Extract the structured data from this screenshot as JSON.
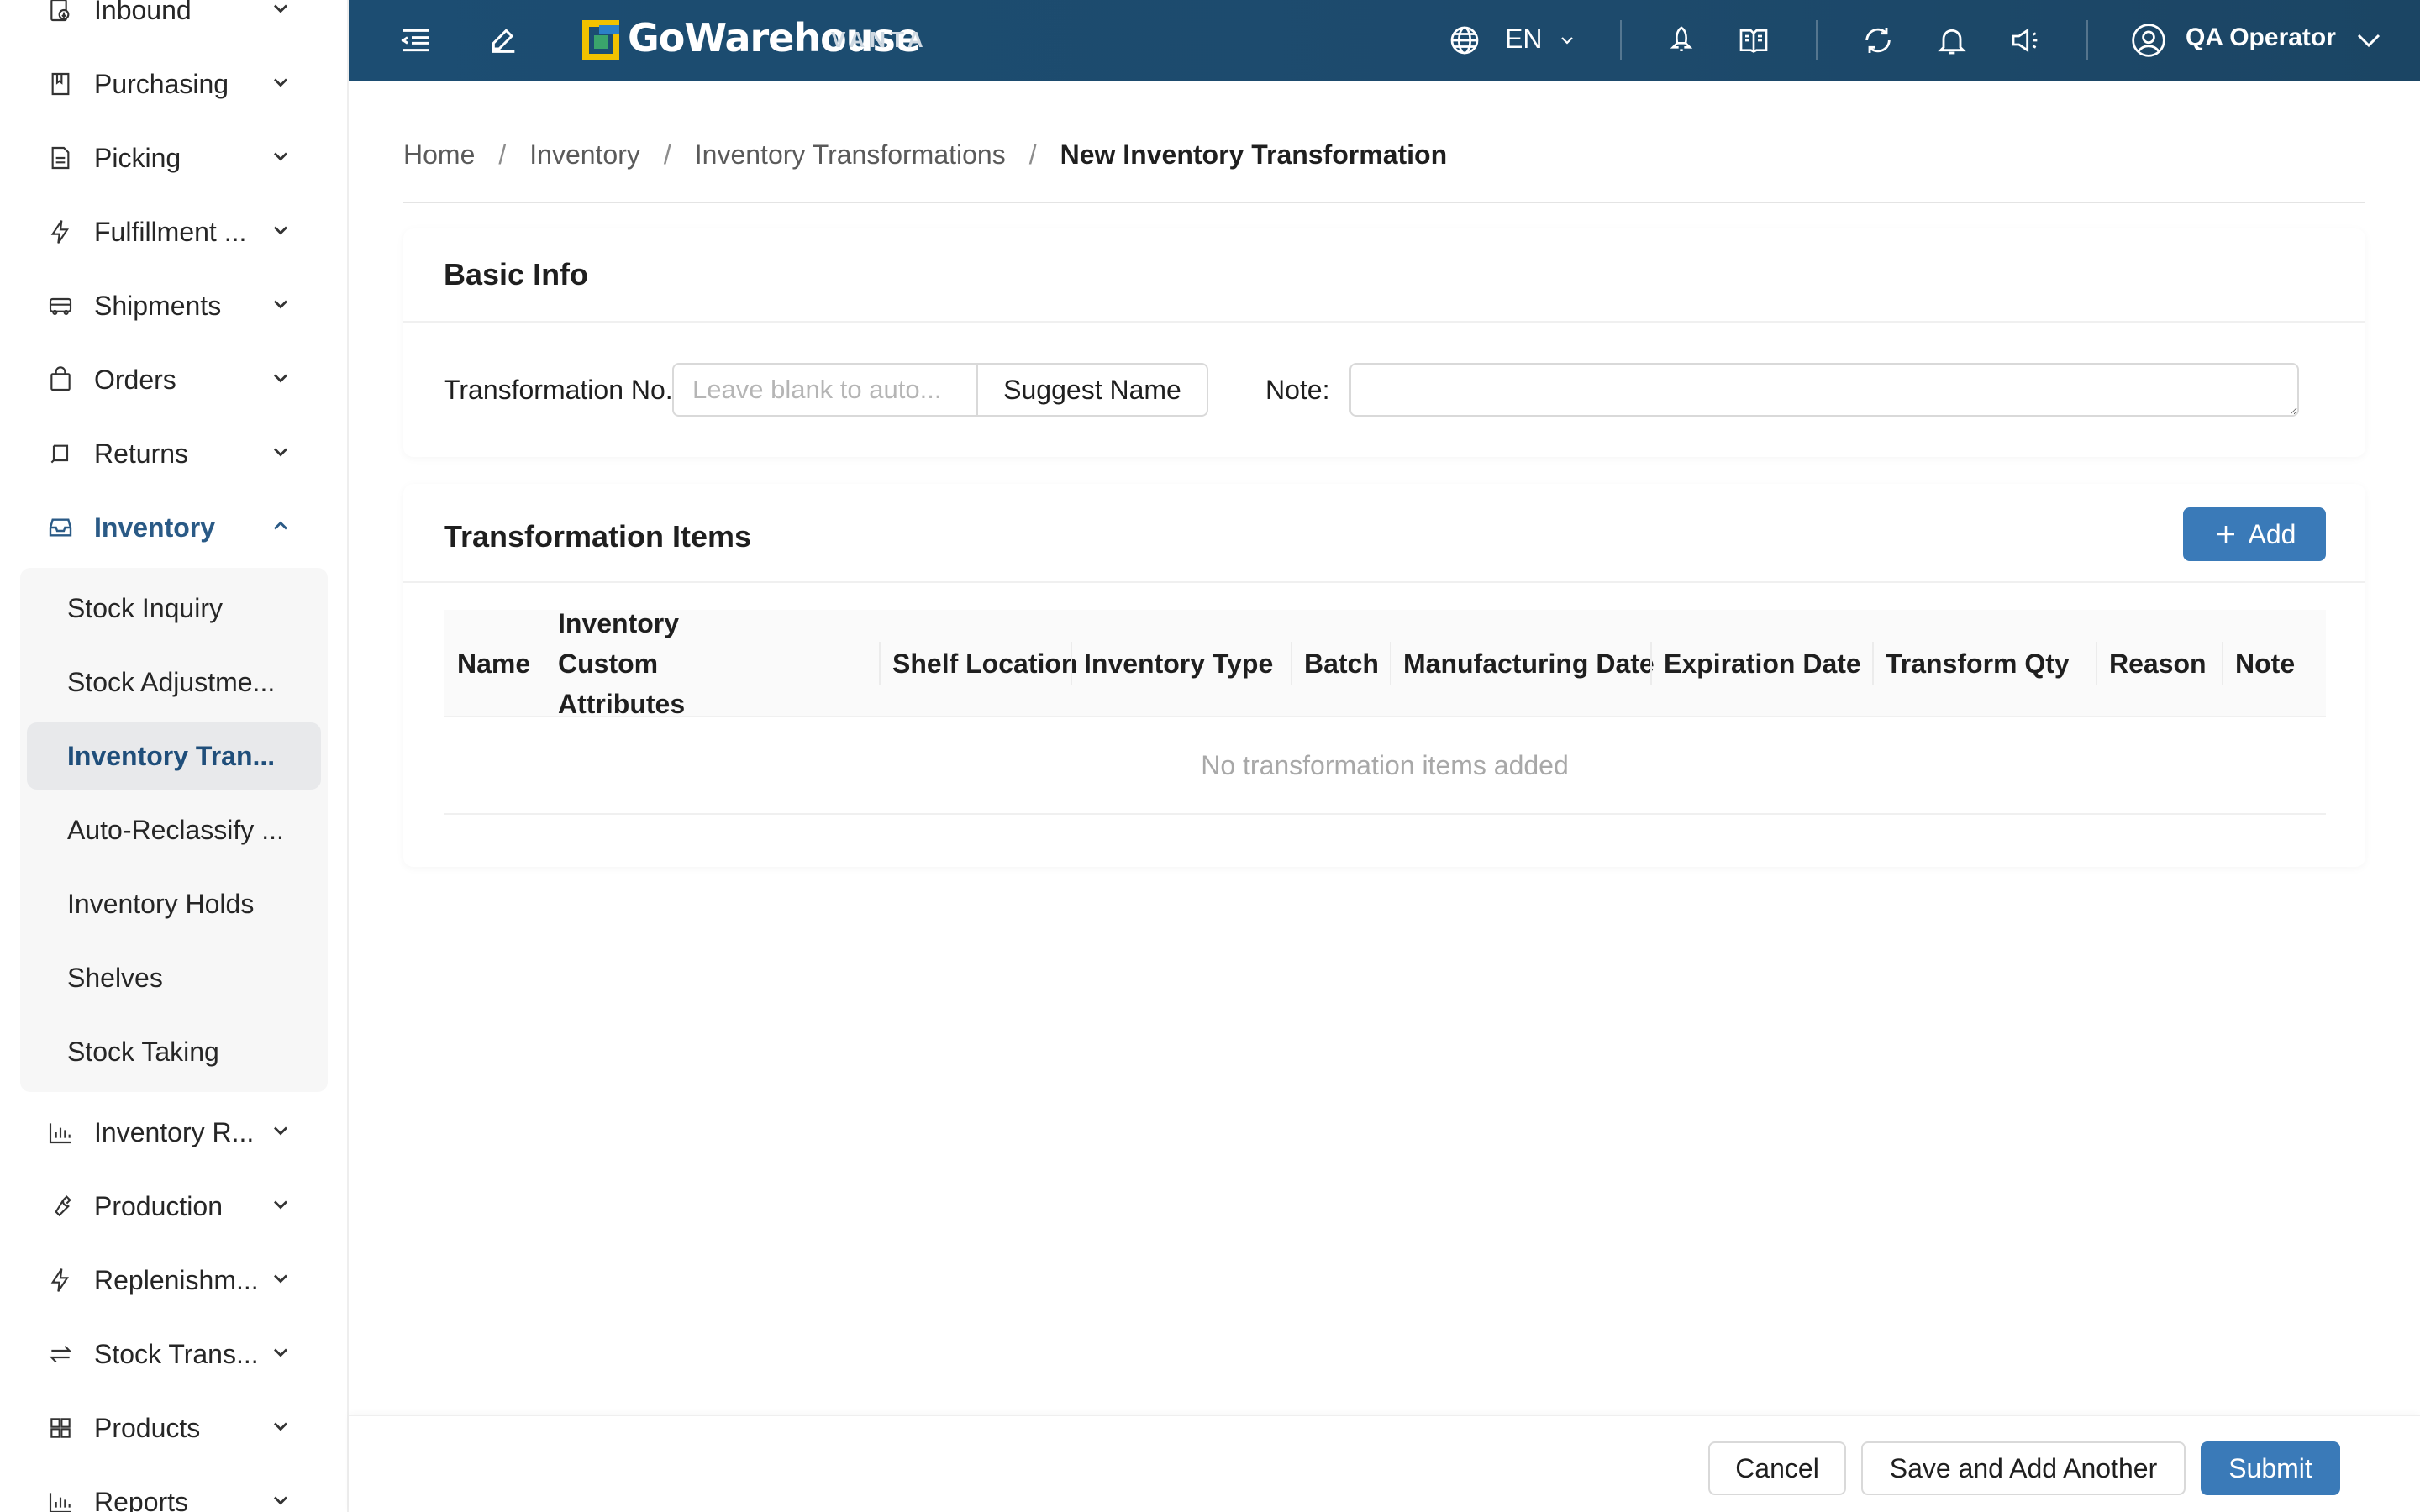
{
  "sidebar": {
    "items": [
      {
        "label": "Inbound",
        "icon": "inbound-icon"
      },
      {
        "label": "Purchasing",
        "icon": "purchasing-icon"
      },
      {
        "label": "Picking",
        "icon": "picking-icon"
      },
      {
        "label": "Fulfillment ...",
        "icon": "lightning-icon"
      },
      {
        "label": "Shipments",
        "icon": "truck-icon"
      },
      {
        "label": "Orders",
        "icon": "bag-icon"
      },
      {
        "label": "Returns",
        "icon": "return-icon"
      },
      {
        "label": "Inventory",
        "icon": "inbox-icon",
        "expanded": true
      },
      {
        "label": "Inventory R...",
        "icon": "bar-chart-icon"
      },
      {
        "label": "Production",
        "icon": "wrench-icon"
      },
      {
        "label": "Replenishm...",
        "icon": "lightning-icon"
      },
      {
        "label": "Stock Trans...",
        "icon": "swap-icon"
      },
      {
        "label": "Products",
        "icon": "grid-icon"
      },
      {
        "label": "Reports",
        "icon": "bar-chart-icon"
      }
    ],
    "inventory_submenu": [
      {
        "label": "Stock Inquiry"
      },
      {
        "label": "Stock Adjustme..."
      },
      {
        "label": "Inventory Tran...",
        "active": true
      },
      {
        "label": "Auto-Reclassify ..."
      },
      {
        "label": "Inventory Holds"
      },
      {
        "label": "Shelves"
      },
      {
        "label": "Stock Taking"
      }
    ]
  },
  "header": {
    "brand_name": "GoWarehouse",
    "brand_sub": "VANTA",
    "language": "EN",
    "user_name": "QA Operator"
  },
  "breadcrumb": {
    "items": [
      "Home",
      "Inventory",
      "Inventory Transformations"
    ],
    "current": "New Inventory Transformation"
  },
  "basic_info": {
    "title": "Basic Info",
    "transformation_no_label": "Transformation No.",
    "transformation_no_value": "",
    "transformation_no_placeholder": "Leave blank to auto...",
    "suggest_button": "Suggest Name",
    "note_label": "Note",
    "note_value": ""
  },
  "items_section": {
    "title": "Transformation Items",
    "add_button": "Add",
    "columns": [
      "Name",
      "Inventory Custom Attributes",
      "Shelf Location",
      "Inventory Type",
      "Batch",
      "Manufacturing Date",
      "Expiration Date",
      "Transform Qty",
      "Reason",
      "Note"
    ],
    "empty_text": "No transformation items added"
  },
  "footer": {
    "cancel": "Cancel",
    "save_add_another": "Save and Add Another",
    "submit": "Submit"
  },
  "colors": {
    "header_bg": "#1c4d72",
    "primary": "#3a7ab8",
    "active_menu_text": "#2a5a86"
  }
}
